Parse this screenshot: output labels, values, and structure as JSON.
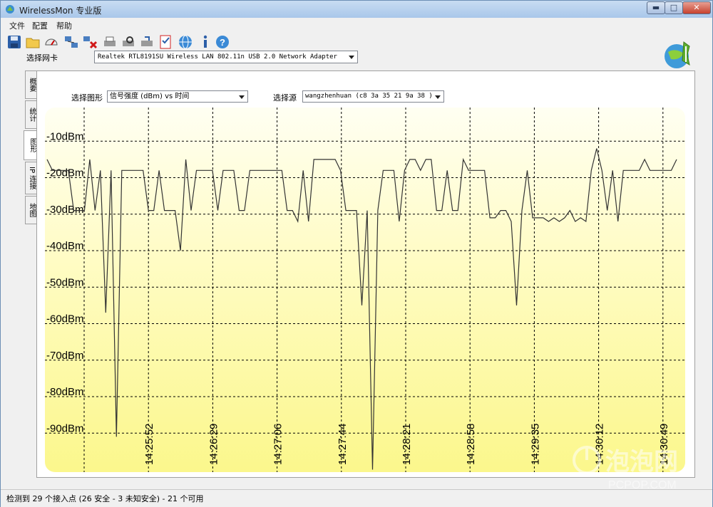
{
  "window": {
    "title": "WirelessMon 专业版",
    "controls": {
      "minimize": "▬",
      "maximize": "□",
      "close": "✕"
    }
  },
  "menu": [
    "文件",
    "配置",
    "帮助"
  ],
  "toolbar": {
    "icons": [
      "save-icon",
      "open-folder-icon",
      "speedometer-icon",
      "network-computers-icon",
      "disconnect-icon",
      "printer-icon",
      "print-preview-icon",
      "print-setup-icon",
      "checklist-icon",
      "globe-icon",
      "info-icon",
      "help-icon"
    ]
  },
  "nic": {
    "label": "选择网卡",
    "value": "Realtek RTL8191SU Wireless LAN 802.11n USB 2.0 Network Adapter"
  },
  "tabs": [
    "概要",
    "统计",
    "图形",
    "IP 连接",
    "地图"
  ],
  "active_tab": "图形",
  "graph_controls": {
    "graph_label": "选择图形",
    "graph_value": "信号强度 (dBm) vs 时间",
    "source_label": "选择源",
    "source_value": "wangzhenhuan (c8 3a 35 21 9a 38 )"
  },
  "chart_data": {
    "type": "line",
    "title": "",
    "xlabel": "",
    "ylabel": "",
    "y_ticks": [
      "-10dBm",
      "-20dBm",
      "-30dBm",
      "-40dBm",
      "-50dBm",
      "-60dBm",
      "-70dBm",
      "-80dBm",
      "-90dBm"
    ],
    "y_tick_values": [
      -10,
      -20,
      -30,
      -40,
      -50,
      -60,
      -70,
      -80,
      -90
    ],
    "ylim": [
      -100,
      0
    ],
    "x_ticks": [
      "14:25:52",
      "14:26:29",
      "14:27:06",
      "14:27:44",
      "14:28:21",
      "14:28:58",
      "14:29:35",
      "14:30:12",
      "14:30:49"
    ],
    "grid": true,
    "series": [
      {
        "values": [
          -15,
          -18,
          -18,
          -18,
          -18,
          -29,
          -29,
          -29,
          -15,
          -29,
          -18,
          -57,
          -18,
          -91,
          -18,
          -18,
          -18,
          -18,
          -18,
          -29,
          -29,
          -18,
          -29,
          -29,
          -29,
          -40,
          -15,
          -29,
          -18,
          -18,
          -18,
          -18,
          -29,
          -18,
          -18,
          -18,
          -29,
          -29,
          -18,
          -18,
          -18,
          -18,
          -18,
          -18,
          -18,
          -29,
          -29,
          -32,
          -18,
          -32,
          -15,
          -15,
          -15,
          -15,
          -15,
          -18,
          -29,
          -29,
          -29,
          -55,
          -29,
          -100,
          -29,
          -18,
          -18,
          -18,
          -32,
          -18,
          -15,
          -15,
          -18,
          -15,
          -15,
          -29,
          -29,
          -18,
          -29,
          -29,
          -15,
          -18,
          -18,
          -18,
          -18,
          -31,
          -31,
          -29,
          -29,
          -32,
          -55,
          -29,
          -18,
          -31,
          -31,
          -31,
          -32,
          -31,
          -32,
          -31,
          -29,
          -32,
          -31,
          -32,
          -18,
          -12,
          -18,
          -29,
          -18,
          -32,
          -18,
          -18,
          -18,
          -18,
          -15,
          -18,
          -18,
          -18,
          -18,
          -18,
          -15
        ]
      }
    ]
  },
  "status": "检测到 29 个接入点 (26 安全 - 3 未知安全) - 21 个可用",
  "watermark": {
    "text": "泡泡网",
    "sub": "PCPOP.COM"
  }
}
